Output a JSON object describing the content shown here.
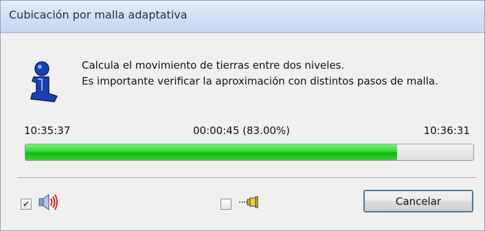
{
  "window": {
    "title": "Cubicación por malla adaptativa"
  },
  "message": {
    "line1": "Calcula el movimiento de tierras entre dos niveles.",
    "line2": "Es importante verificar la aproximación con distintos pasos de malla."
  },
  "progress": {
    "start_time": "10:35:37",
    "elapsed": "00:00:45 (83.00%)",
    "end_time": "10:36:31",
    "percent": 83.0
  },
  "footer": {
    "sound_checkbox_checked": true,
    "pin_checkbox_checked": false,
    "cancel_label": "Cancelar"
  },
  "icons": {
    "info": "info-icon",
    "sound": "speaker-icon",
    "pin": "pin-icon"
  },
  "colors": {
    "progress_fill": "#12b812",
    "titlebar": "#d2e2f5"
  }
}
